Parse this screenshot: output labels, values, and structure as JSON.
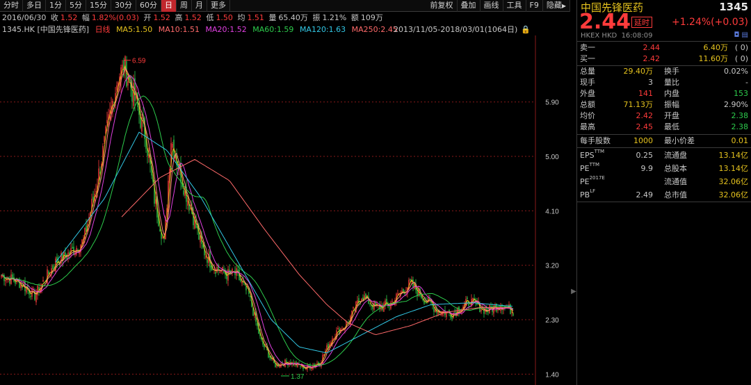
{
  "toolbar": {
    "left_tabs": [
      "分时",
      "多日",
      "1分",
      "5分",
      "15分",
      "30分",
      "60分",
      "日",
      "周",
      "月",
      "更多"
    ],
    "active_tab": "日",
    "right_tabs": [
      "前复权",
      "叠加",
      "画线",
      "工具",
      "F9",
      "隐藏"
    ]
  },
  "quote": {
    "date": "2016/06/30",
    "close_label": "收",
    "close": "1.52",
    "change_label": "幅",
    "change": "1.82%(0.03)",
    "open_label": "开",
    "open": "1.52",
    "high_label": "高",
    "high": "1.52",
    "low_label": "低",
    "low": "1.50",
    "avg_label": "均",
    "avg": "1.51",
    "vol_label": "量",
    "vol": "65.40万",
    "amp_label": "振",
    "amp": "1.21%",
    "amount_label": "额",
    "amount": "109万"
  },
  "ma_row": {
    "symbol": "1345.HK [中国先锋医药]",
    "period": "日线",
    "ma5": "MA5:1.50",
    "ma10": "MA10:1.51",
    "ma20": "MA20:1.52",
    "ma60": "MA60:1.59",
    "ma120": "MA120:1.63",
    "ma250": "MA250:2.45",
    "range": "2013/11/05-2018/03/01(1064日)",
    "lock": "🔒"
  },
  "chart_data": {
    "type": "candlestick",
    "y_ticks": [
      "5.90",
      "5.00",
      "4.10",
      "3.20",
      "2.30",
      "1.40"
    ],
    "ylim": [
      1.22,
      7.0
    ],
    "max_label": "6.59",
    "min_label": "1.37",
    "colors": {
      "up": "#ff3b3b",
      "down": "#2dcc4c",
      "ma5": "#e6c31e",
      "ma10": "#ff8080",
      "ma20": "#e040e0",
      "ma60": "#2dcc4c",
      "ma120": "#32c8e6",
      "ma250": "#ff6a6a"
    },
    "price_path": [
      [
        0,
        3.05
      ],
      [
        30,
        2.9
      ],
      [
        50,
        2.7
      ],
      [
        80,
        3.25
      ],
      [
        100,
        3.4
      ],
      [
        120,
        3.6
      ],
      [
        140,
        4.6
      ],
      [
        155,
        5.5
      ],
      [
        170,
        6.35
      ],
      [
        180,
        6.45
      ],
      [
        195,
        5.9
      ],
      [
        210,
        5.3
      ],
      [
        222,
        4.3
      ],
      [
        236,
        3.55
      ],
      [
        246,
        5.3
      ],
      [
        262,
        4.6
      ],
      [
        278,
        4.0
      ],
      [
        290,
        3.5
      ],
      [
        305,
        3.2
      ],
      [
        325,
        3.05
      ],
      [
        340,
        3.05
      ],
      [
        358,
        2.7
      ],
      [
        375,
        1.95
      ],
      [
        395,
        1.55
      ],
      [
        415,
        1.6
      ],
      [
        440,
        1.5
      ],
      [
        460,
        1.6
      ],
      [
        480,
        2.05
      ],
      [
        500,
        2.25
      ],
      [
        520,
        2.7
      ],
      [
        540,
        2.5
      ],
      [
        560,
        2.55
      ],
      [
        590,
        2.9
      ],
      [
        610,
        2.65
      ],
      [
        630,
        2.45
      ],
      [
        650,
        2.4
      ],
      [
        675,
        2.6
      ],
      [
        700,
        2.45
      ],
      [
        720,
        2.55
      ],
      [
        738,
        2.44
      ]
    ],
    "ma120_path": [
      [
        80,
        3.25
      ],
      [
        150,
        4.3
      ],
      [
        200,
        5.4
      ],
      [
        240,
        5.1
      ],
      [
        290,
        4.3
      ],
      [
        340,
        3.3
      ],
      [
        390,
        2.3
      ],
      [
        430,
        1.85
      ],
      [
        470,
        1.75
      ],
      [
        520,
        2.05
      ],
      [
        570,
        2.35
      ],
      [
        620,
        2.55
      ],
      [
        680,
        2.58
      ],
      [
        738,
        2.52
      ]
    ],
    "ma250_path": [
      [
        175,
        4.0
      ],
      [
        230,
        4.65
      ],
      [
        280,
        4.95
      ],
      [
        330,
        4.6
      ],
      [
        380,
        3.8
      ],
      [
        430,
        3.05
      ],
      [
        470,
        2.55
      ],
      [
        500,
        2.25
      ],
      [
        540,
        2.05
      ],
      [
        590,
        2.2
      ],
      [
        640,
        2.42
      ],
      [
        690,
        2.5
      ],
      [
        738,
        2.5
      ]
    ]
  },
  "panel": {
    "name": "中国先锋医药",
    "code": "1345",
    "price": "2.44",
    "delay": "延时",
    "change": "+1.24%(+0.03)",
    "exchange": "HKEX HKD",
    "time": "16:08:09",
    "icons": "◘ ▤",
    "orderbook": [
      {
        "label": "卖一",
        "price": "2.44",
        "vol": "6.40万",
        "count": "(  0)"
      },
      {
        "label": "买一",
        "price": "2.42",
        "vol": "11.60万",
        "count": "(  0)"
      }
    ],
    "stats": [
      {
        "l1": "总量",
        "v1": "29.40万",
        "l2": "换手",
        "v2": "0.02%"
      },
      {
        "l1": "现手",
        "v1": "3",
        "l2": "量比",
        "v2": "-"
      },
      {
        "l1": "外盘",
        "v1": "141",
        "l2": "内盘",
        "v2": "153"
      },
      {
        "l1": "总额",
        "v1": "71.13万",
        "l2": "振幅",
        "v2": "2.90%"
      },
      {
        "l1": "均价",
        "v1": "2.42",
        "l2": "开盘",
        "v2": "2.38"
      },
      {
        "l1": "最高",
        "v1": "2.45",
        "l2": "最低",
        "v2": "2.38"
      }
    ],
    "lot": {
      "l1": "每手股数",
      "v1": "1000",
      "l2": "最小价差",
      "v2": "0.01"
    },
    "fundamentals": [
      {
        "l1": "EPS",
        "sup": "TTM",
        "v1": "0.25",
        "l2": "流通盘",
        "v2": "13.14亿"
      },
      {
        "l1": "PE",
        "sup": "TTM",
        "v1": "9.9",
        "l2": "总股本",
        "v2": "13.14亿"
      },
      {
        "l1": "PE",
        "sup": "2017E",
        "v1": "",
        "l2": "流通值",
        "v2": "32.06亿"
      },
      {
        "l1": "PB",
        "sup": "LF",
        "v1": "2.49",
        "l2": "总市值",
        "v2": "32.06亿"
      }
    ]
  }
}
